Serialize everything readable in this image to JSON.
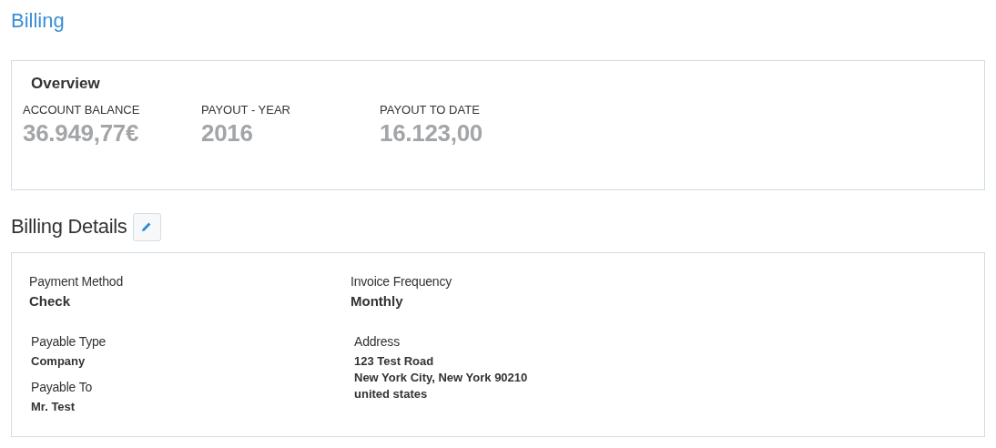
{
  "page_title": "Billing",
  "overview": {
    "title": "Overview",
    "stats": [
      {
        "label": "ACCOUNT BALANCE",
        "value": "36.949,77€"
      },
      {
        "label": "PAYOUT - YEAR",
        "value": "2016"
      },
      {
        "label": "PAYOUT TO DATE",
        "value": "16.123,00"
      }
    ]
  },
  "billing_details": {
    "title": "Billing Details",
    "top_fields": [
      {
        "label": "Payment Method",
        "value": "Check"
      },
      {
        "label": "Invoice Frequency",
        "value": "Monthly"
      }
    ],
    "left_fields": [
      {
        "label": "Payable Type",
        "value": "Company"
      },
      {
        "label": "Payable To",
        "value": "Mr. Test"
      }
    ],
    "address": {
      "label": "Address",
      "lines": [
        "123 Test Road",
        "New York City, New York 90210",
        "united states"
      ]
    }
  }
}
